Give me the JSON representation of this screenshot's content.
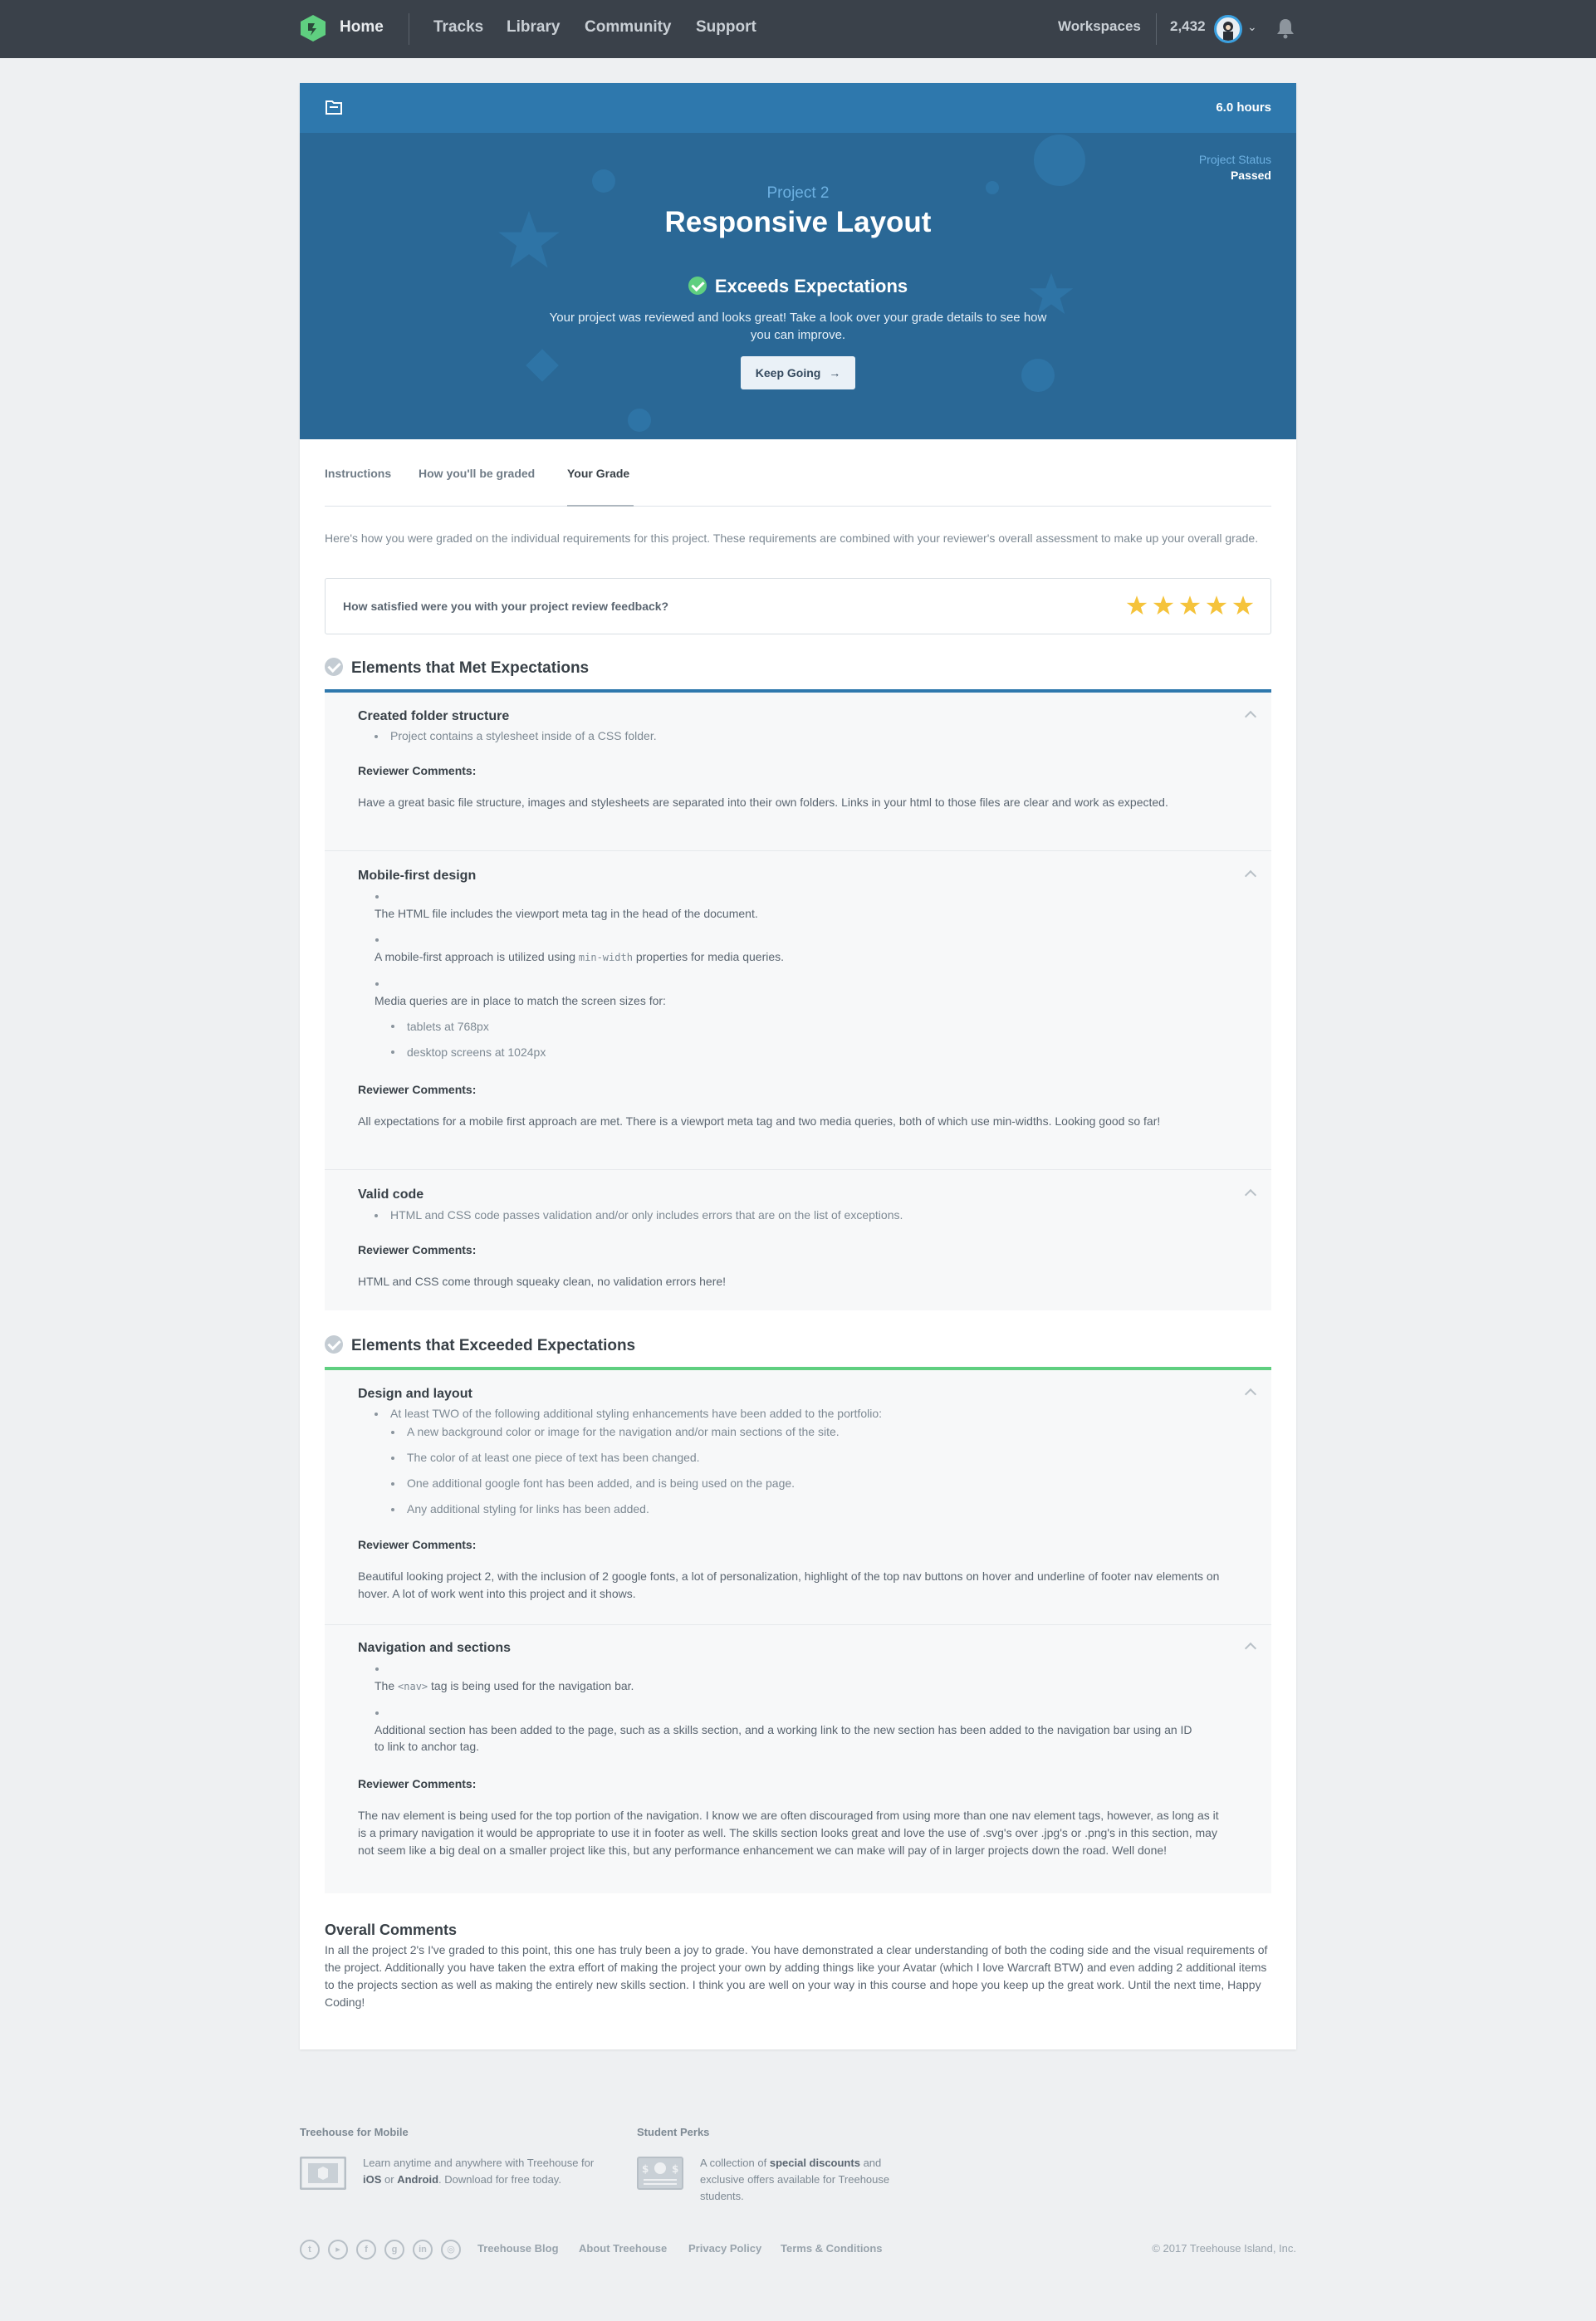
{
  "nav": {
    "home": "Home",
    "links": [
      "Tracks",
      "Library",
      "Community",
      "Support"
    ],
    "workspaces": "Workspaces",
    "points": "2,432"
  },
  "hero": {
    "hours": "6.0 hours",
    "status_label": "Project Status",
    "status_value": "Passed",
    "project_number": "Project 2",
    "project_title": "Responsive Layout",
    "grade": "Exceeds Expectations",
    "message": "Your project was reviewed and looks great! Take a look over your grade details to see how you can improve.",
    "button": "Keep Going"
  },
  "tabs": [
    "Instructions",
    "How you'll be graded",
    "Your Grade"
  ],
  "intro": "Here's how you were graded on the individual requirements for this project. These requirements are combined with your reviewer's overall assessment to make up your overall grade.",
  "rating": {
    "question": "How satisfied were you with your project review feedback?",
    "stars": 5,
    "star_color": "#f5c33b"
  },
  "reviewer_label": "Reviewer Comments:",
  "met": {
    "title": "Elements that Met Expectations",
    "accent": "#2e78ad",
    "items": [
      {
        "title": "Created folder structure",
        "bullets": [
          "Project contains a stylesheet inside of a CSS folder."
        ],
        "comment": "Have a great basic file structure, images and stylesheets are separated into their own folders. Links in your html to those files are clear and work as expected."
      },
      {
        "title": "Mobile-first design",
        "b1": "The HTML file includes the viewport meta tag in the head of the document.",
        "b2_pre": "A mobile-first approach is utilized using",
        "b2_code": "min-width",
        "b2_post": "properties for media queries.",
        "b3": "Media queries are in place to match the screen sizes for:",
        "sub": [
          "tablets at 768px",
          "desktop screens at 1024px"
        ],
        "comment": "All expectations for a mobile first approach are met. There is a viewport meta tag and two media queries, both of which use min-widths. Looking good so far!"
      },
      {
        "title": "Valid code",
        "bullets": [
          "HTML and CSS code passes validation and/or only includes errors that are on the list of exceptions."
        ],
        "comment": "HTML and CSS come through squeaky clean, no validation errors here!"
      }
    ]
  },
  "exceeded": {
    "title": "Elements that Exceeded Expectations",
    "accent": "#5fcf80",
    "items": [
      {
        "title": "Design and layout",
        "lead": "At least TWO of the following additional styling enhancements have been added to the portfolio:",
        "sub": [
          "A new background color or image for the navigation and/or main sections of the site.",
          "The color of at least one piece of text has been changed.",
          "One additional google font has been added, and is being used on the page.",
          "Any additional styling for links has been added."
        ],
        "comment": "Beautiful looking project 2, with the inclusion of 2 google fonts, a lot of personalization, highlight of the top nav buttons on hover and underline of footer nav elements on hover. A lot of work went into this project and it shows."
      },
      {
        "title": "Navigation and sections",
        "b1_pre": "The",
        "b1_code": "<nav>",
        "b1_post": "tag is being used for the navigation bar.",
        "b2": "Additional section has been added to the page, such as a skills section, and a working link to the new section has been added to the navigation bar using an ID to link to anchor tag.",
        "comment": "The nav element is being used for the top portion of the navigation. I know we are often discouraged from using more than one nav element tags, however, as long as it is a primary navigation it would be appropriate to use it in footer as well. The skills section looks great and love the use of .svg's over .jpg's or .png's in this section, may not seem like a big deal on a smaller project like this, but any performance enhancement we can make will pay of in larger projects down the road. Well done!"
      }
    ]
  },
  "overall": {
    "title": "Overall Comments",
    "text": "In all the project 2's I've graded to this point, this one has truly been a joy to grade. You have demonstrated a clear understanding of both the coding side and the visual requirements of the project. Additionally you have taken the extra effort of making the project your own by adding things like your Avatar (which I love Warcraft BTW) and even adding 2 additional items to the projects section as well as making the entirely new skills section. I think you are well on your way in this course and hope you keep up the great work. Until the next time, Happy Coding!"
  },
  "footer": {
    "mobile_title": "Treehouse for Mobile",
    "mobile_pre": "Learn anytime and anywhere with Treehouse for",
    "mobile_ios": "iOS",
    "mobile_or": "or",
    "mobile_android": "Android",
    "mobile_post": ". Download for free today.",
    "perks_title": "Student Perks",
    "perks_pre": "A collection of",
    "perks_bold": "special discounts",
    "perks_post": "and exclusive offers available for Treehouse students.",
    "social": [
      "twitter-icon",
      "youtube-icon",
      "facebook-icon",
      "googleplus-icon",
      "linkedin-icon",
      "instagram-icon"
    ],
    "links": [
      "Treehouse Blog",
      "About Treehouse",
      "Privacy Policy",
      "Terms & Conditions"
    ],
    "copyright": "© 2017 Treehouse Island, Inc."
  }
}
